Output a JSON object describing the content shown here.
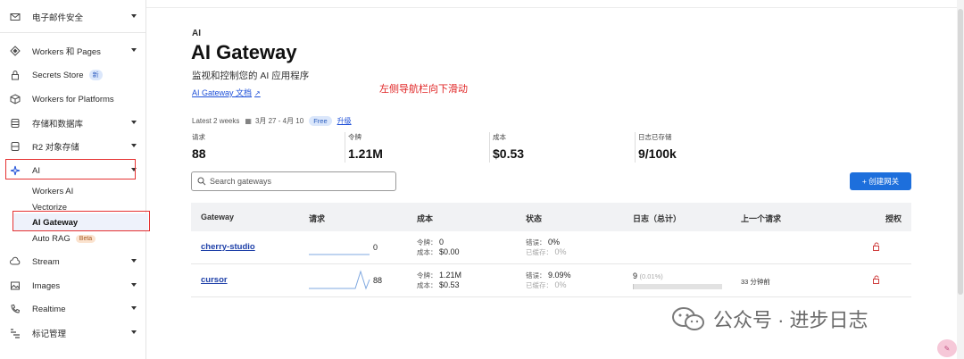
{
  "sidebar": {
    "items": [
      {
        "label": "电子邮件安全",
        "icon": "mail-icon",
        "caret": true
      },
      {
        "label": "Workers 和 Pages",
        "icon": "workers-icon",
        "caret": true
      },
      {
        "label": "Secrets Store",
        "icon": "lock-icon",
        "badge": "新",
        "caret": false
      },
      {
        "label": "Workers for Platforms",
        "icon": "cube-icon",
        "caret": false
      },
      {
        "label": "存储和数据库",
        "icon": "database-icon",
        "caret": true
      },
      {
        "label": "R2 对象存储",
        "icon": "bucket-icon",
        "caret": true
      },
      {
        "label": "AI",
        "icon": "sparkle-icon",
        "caret": true
      },
      {
        "label": "Stream",
        "icon": "cloud-icon",
        "caret": true
      },
      {
        "label": "Images",
        "icon": "image-icon",
        "caret": true
      },
      {
        "label": "Realtime",
        "icon": "phone-icon",
        "caret": true
      },
      {
        "label": "标记管理",
        "icon": "tag-icon",
        "caret": true
      }
    ],
    "ai_sub": [
      "Workers AI",
      "Vectorize",
      "AI Gateway",
      "Auto RAG"
    ],
    "beta_badge": "Beta"
  },
  "page": {
    "crumb": "AI",
    "title": "AI Gateway",
    "subtitle": "监视和控制您的 AI 应用程序",
    "doc_link": "AI Gateway 文档",
    "annotation": "左侧导航栏向下滑动"
  },
  "filter": {
    "range": "Latest 2 weeks",
    "dates": "3月 27 - 4月 10",
    "plan": "Free",
    "upgrade": "升级"
  },
  "metrics": [
    {
      "label": "请求",
      "value": "88"
    },
    {
      "label": "令牌",
      "value": "1.21M"
    },
    {
      "label": "成本",
      "value": "$0.53"
    },
    {
      "label": "日志已存储",
      "value": "9/100k"
    }
  ],
  "search": {
    "placeholder": "Search gateways"
  },
  "create_button": "+ 创建网关",
  "table": {
    "headers": [
      "Gateway",
      "请求",
      "成本",
      "状态",
      "日志（总计）",
      "上一个请求",
      "授权"
    ],
    "rows": [
      {
        "name": "cherry-studio",
        "requests": "0",
        "tokens_label": "令牌：",
        "tokens": "0",
        "cost_label": "成本：",
        "cost": "$0.00",
        "error_label": "错误：",
        "error": "0%",
        "cache_label": "已缓存：",
        "cache": "0%",
        "logs": "",
        "logs_pct": "",
        "log_fill": 0,
        "last": ""
      },
      {
        "name": "cursor",
        "requests": "88",
        "tokens_label": "令牌：",
        "tokens": "1.21M",
        "cost_label": "成本：",
        "cost": "$0.53",
        "error_label": "错误：",
        "error": "9.09%",
        "cache_label": "已缓存：",
        "cache": "0%",
        "logs": "9",
        "logs_pct": "(0.01%)",
        "log_fill": 0.0001,
        "last": "33 分钟前"
      }
    ]
  },
  "watermark": "公众号 · 进步日志"
}
